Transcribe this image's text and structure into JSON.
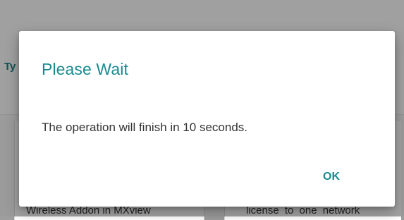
{
  "background": {
    "tab_label": "Ty",
    "card_left_text": "Wireless Addon in MXview",
    "card_right_text": "license to one network"
  },
  "dialog": {
    "title": "Please Wait",
    "message": "The operation will finish in 10 seconds.",
    "ok_label": "OK"
  },
  "colors": {
    "accent": "#1a8a8e",
    "text": "#333333",
    "scrim": "rgba(0,0,0,0.36)"
  }
}
